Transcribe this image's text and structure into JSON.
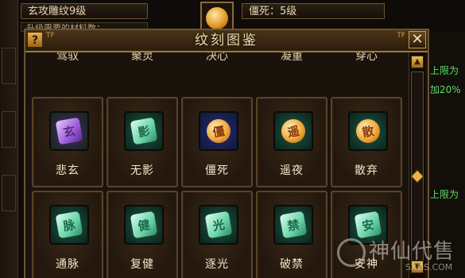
{
  "background": {
    "top_left_bar": "玄攻雕纹9级",
    "second_bar": "升级需要的材料数：",
    "top_right_bar": "僵死：5级",
    "side_texts": [
      "上限为",
      "加20%",
      "上限为"
    ],
    "watermark_text": "神仙代售",
    "watermark_url": "SXDS.COM"
  },
  "dialog": {
    "title": "纹刻图鉴",
    "help_label": "?",
    "close_label": "✕",
    "corner_marks": [
      "TF",
      "TF"
    ],
    "partial_row": [
      "驾驭",
      "聚灵",
      "决心",
      "凝重",
      "穿心"
    ],
    "rows": [
      [
        {
          "label": "悲玄",
          "glyph": "玄",
          "style": "purple",
          "icon": "purple-rune-icon"
        },
        {
          "label": "无影",
          "glyph": "影",
          "style": "jade",
          "icon": "jade-rune-icon"
        },
        {
          "label": "僵死",
          "glyph": "僵",
          "style": "gold",
          "icon": "gold-coin-rune-icon"
        },
        {
          "label": "遥夜",
          "glyph": "遥",
          "style": "gold2",
          "icon": "gold-coin-rune-icon"
        },
        {
          "label": "散弃",
          "glyph": "散",
          "style": "gold2",
          "icon": "gold-coin-rune-icon"
        }
      ],
      [
        {
          "label": "通脉",
          "glyph": "脉",
          "style": "jade",
          "icon": "jade-rune-icon"
        },
        {
          "label": "复健",
          "glyph": "健",
          "style": "jade",
          "icon": "jade-rune-icon"
        },
        {
          "label": "逐光",
          "glyph": "光",
          "style": "jade",
          "icon": "jade-rune-icon"
        },
        {
          "label": "破禁",
          "glyph": "禁",
          "style": "jade",
          "icon": "jade-rune-icon"
        },
        {
          "label": "安神",
          "glyph": "安",
          "style": "jade",
          "icon": "jade-rune-icon"
        }
      ]
    ]
  },
  "scrollbar": {
    "up_label": "▲",
    "down_label": "▼"
  },
  "colors": {
    "accent_gold": "#c89a52",
    "label_text": "#f4e6c8",
    "green_text": "#5fdc6a"
  }
}
